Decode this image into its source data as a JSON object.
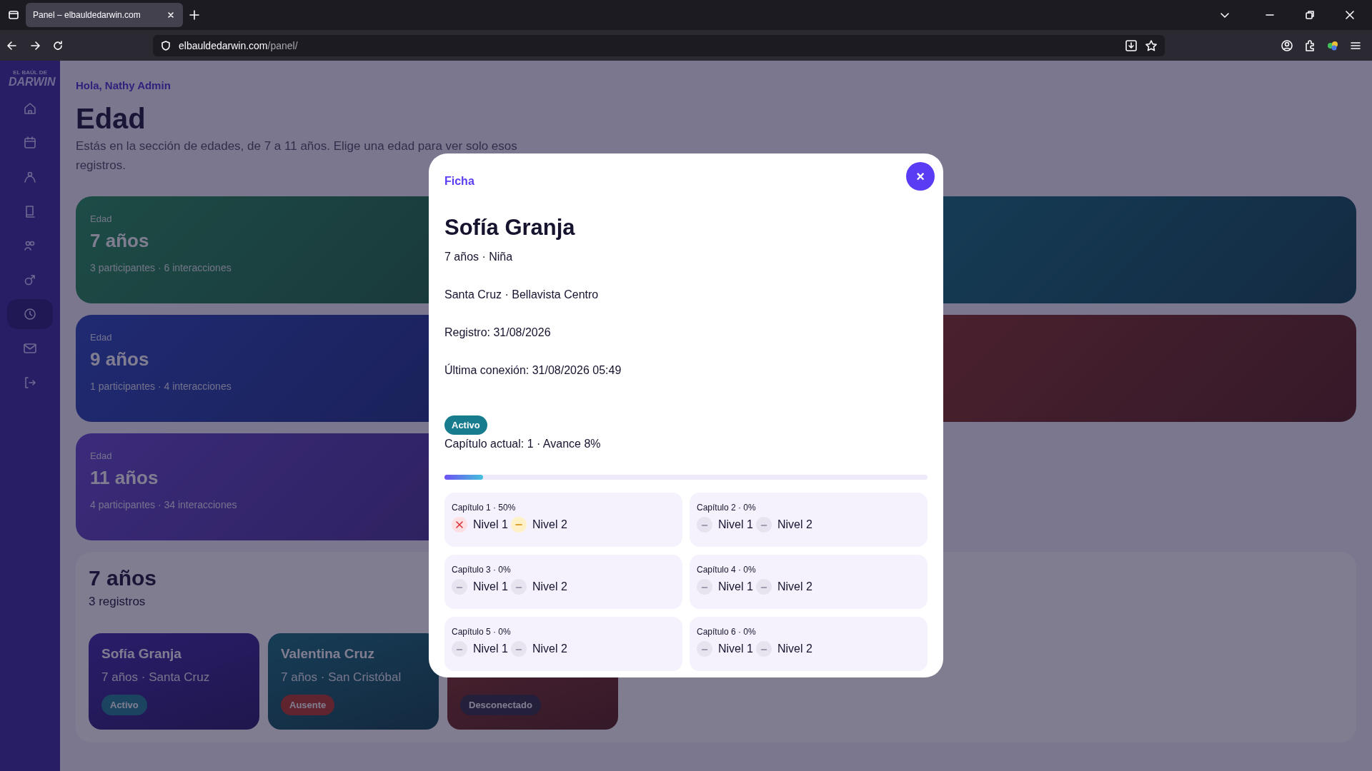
{
  "browser": {
    "tab_title": "Panel – elbauldedarwin.com",
    "url_host": "elbauldedarwin.com",
    "url_path": "/panel/"
  },
  "sidebar": {
    "logo_top": "EL BAÚL DE",
    "logo_main": "DARWIN",
    "items": [
      {
        "selected": false
      },
      {
        "selected": false
      },
      {
        "selected": false
      },
      {
        "selected": false
      },
      {
        "selected": false
      },
      {
        "selected": false
      },
      {
        "selected": true
      },
      {
        "selected": false
      },
      {
        "selected": false
      }
    ]
  },
  "greeting": "Hola, Nathy Admin",
  "title": "Edad",
  "description": "Estás en la sección de edades, de 7 a 11 años. Elige una edad para ver solo esos registros.",
  "age_groups": [
    {
      "kind": "age",
      "label": "Edad",
      "title": "7 años",
      "stats": "3 participantes · 6 interacciones"
    },
    {
      "kind": "covered"
    },
    {
      "kind": "age",
      "label": "Edad",
      "title": "9 años",
      "stats": "1 participantes · 4 interacciones"
    },
    {
      "kind": "covered"
    },
    {
      "kind": "age",
      "label": "Edad",
      "title": "11 años",
      "stats": "4 participantes · 34 interacciones"
    }
  ],
  "section": {
    "title": "7 años",
    "count": "3 registros",
    "students": [
      {
        "name": "Sofía Granja",
        "info": "7 años · Santa Cruz",
        "status": {
          "text": "Activo",
          "kind": "active"
        }
      },
      {
        "name": "Valentina Cruz",
        "info": "7 años · San Cristóbal",
        "status": {
          "text": "Ausente",
          "kind": "absent"
        }
      },
      {
        "status": {
          "text": "Desconectado",
          "kind": "offline"
        }
      }
    ]
  },
  "modal": {
    "eyebrow": "Ficha",
    "close": "×",
    "name": "Sofía Granja",
    "lines": [
      "7 años · Niña",
      "Santa Cruz · Bellavista Centro",
      "Registro: 31/08/2026",
      "Última conexión: 31/08/2026 05:49"
    ],
    "status": {
      "text": "Activo",
      "kind": "active"
    },
    "progress_text": "Capítulo actual: 1 · Avance 8%",
    "level": 0.08,
    "chapters": [
      {
        "title": "Capítulo 1 · 50%",
        "levels": [
          {
            "label": "Nivel 1",
            "kind": "failed"
          },
          {
            "label": "Nivel 2",
            "kind": "partial"
          }
        ]
      },
      {
        "title": "Capítulo 2 · 0%",
        "levels": [
          {
            "label": "Nivel 1",
            "kind": "pending"
          },
          {
            "label": "Nivel 2",
            "kind": "pending"
          }
        ]
      },
      {
        "title": "Capítulo 3 · 0%",
        "levels": [
          {
            "label": "Nivel 1",
            "kind": "pending"
          },
          {
            "label": "Nivel 2",
            "kind": "pending"
          }
        ]
      },
      {
        "title": "Capítulo 4 · 0%",
        "levels": [
          {
            "label": "Nivel 1",
            "kind": "pending"
          },
          {
            "label": "Nivel 2",
            "kind": "pending"
          }
        ]
      },
      {
        "title": "Capítulo 5 · 0%",
        "levels": [
          {
            "label": "Nivel 1",
            "kind": "pending"
          },
          {
            "label": "Nivel 2",
            "kind": "pending"
          }
        ]
      },
      {
        "title": "Capítulo 6 · 0%",
        "levels": [
          {
            "label": "Nivel 1",
            "kind": "pending"
          },
          {
            "label": "Nivel 2",
            "kind": "pending"
          }
        ]
      }
    ]
  }
}
